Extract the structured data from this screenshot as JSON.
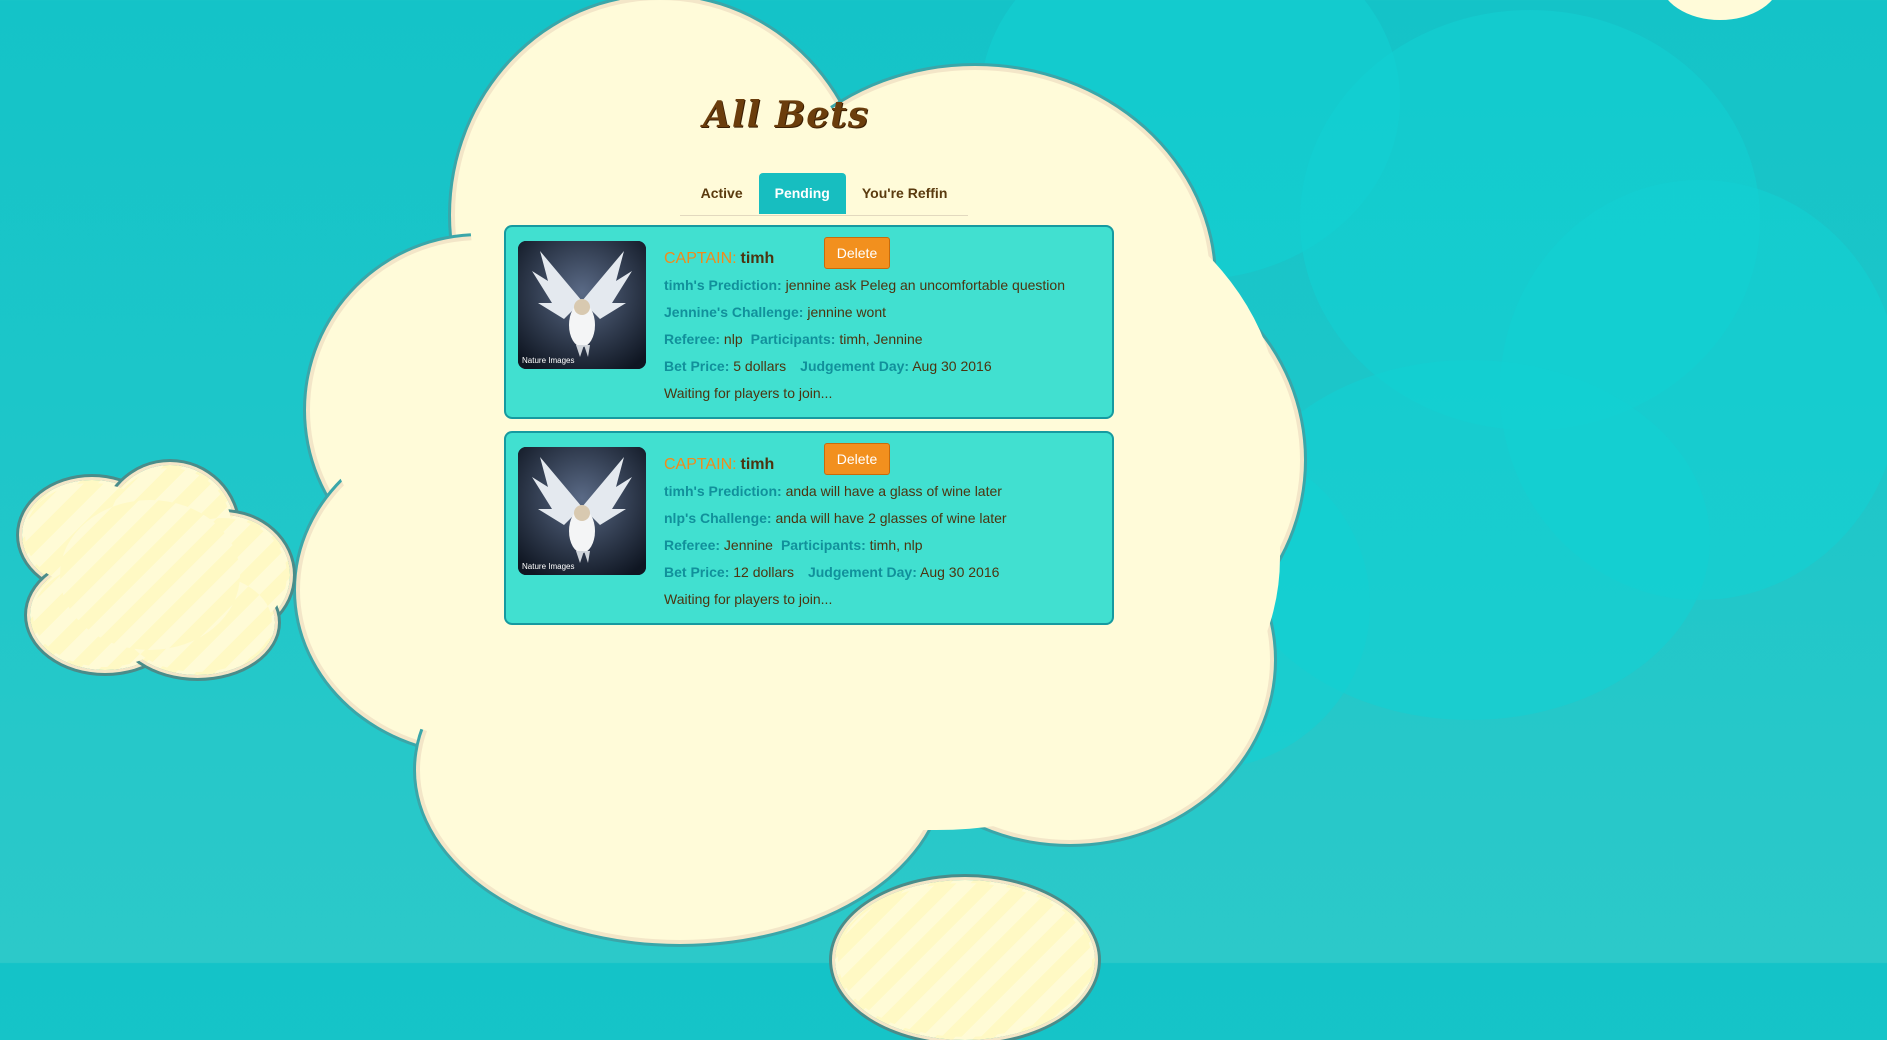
{
  "page": {
    "title": "All Bets"
  },
  "tabs": [
    {
      "label": "Active",
      "active": false
    },
    {
      "label": "Pending",
      "active": true
    },
    {
      "label": "You're Reffin",
      "active": false
    }
  ],
  "labels": {
    "captain": "CAPTAIN:",
    "referee": "Referee:",
    "participants": "Participants:",
    "bet_price": "Bet Price:",
    "judgement_day": "Judgement Day:",
    "delete": "Delete",
    "image_caption": "Nature Images"
  },
  "bets": [
    {
      "captain": "timh",
      "prediction_label": "timh's Prediction:",
      "prediction": "jennine ask Peleg an uncomfortable question",
      "challenge_label": "Jennine's Challenge:",
      "challenge": "jennine wont",
      "referee": "nlp",
      "participants": "timh, Jennine",
      "bet_price": "5 dollars",
      "judgement_day": "Aug 30 2016",
      "status": "Waiting for players to join..."
    },
    {
      "captain": "timh",
      "prediction_label": "timh's Prediction:",
      "prediction": "anda will have a glass of wine later",
      "challenge_label": "nlp's Challenge:",
      "challenge": "anda will have 2 glasses of wine later",
      "referee": "Jennine",
      "participants": "timh, nlp",
      "bet_price": "12 dollars",
      "judgement_day": "Aug 30 2016",
      "status": "Waiting for players to join..."
    }
  ],
  "colors": {
    "background": "#14c3c8",
    "cloud": "#fffbd9",
    "card": "#41e0d0",
    "accent": "#f2901e",
    "label": "#11909b",
    "title": "#6b3d0c"
  },
  "icons": [
    "owl-photo-icon"
  ]
}
